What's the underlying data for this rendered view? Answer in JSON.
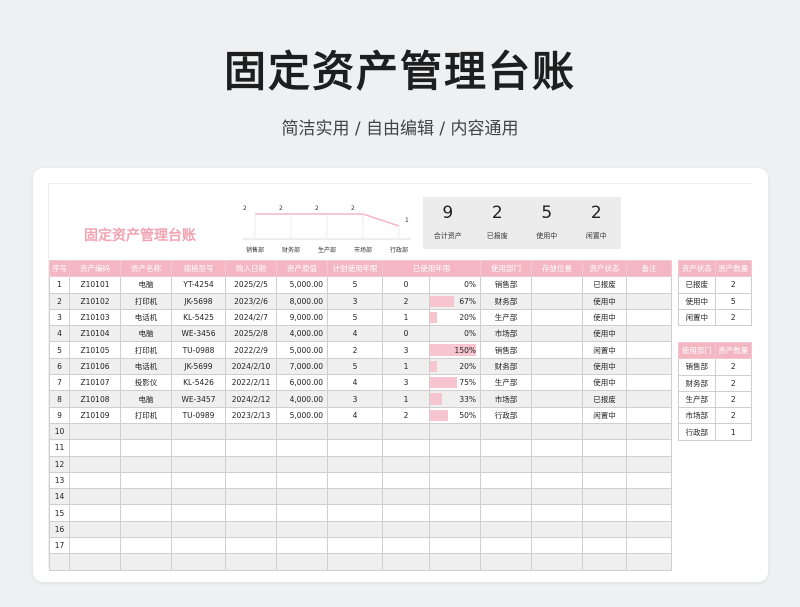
{
  "hero": {
    "title": "固定资产管理台账",
    "subtitle": "简洁实用 / 自由编辑 / 内容通用"
  },
  "sheet": {
    "title": "固定资产管理台账",
    "dept_chart": {
      "type": "line",
      "categories": [
        "销售部",
        "财务部",
        "生产部",
        "市场部",
        "行政部"
      ],
      "values": [
        2,
        2,
        2,
        2,
        1
      ],
      "color": "#f4b6c3"
    },
    "stats": [
      {
        "value": "9",
        "label": "合计资产"
      },
      {
        "value": "2",
        "label": "已报废"
      },
      {
        "value": "5",
        "label": "使用中"
      },
      {
        "value": "2",
        "label": "闲置中"
      }
    ]
  },
  "table": {
    "headers": [
      "序号",
      "资产编码",
      "资产名称",
      "规格型号",
      "购入日期",
      "资产原值",
      "计划使用年限",
      "已使用年限",
      "",
      "使用部门",
      "存放位置",
      "资产状态",
      "备注"
    ],
    "rows": [
      {
        "no": "1",
        "code": "Z10101",
        "name": "电脑",
        "model": "YT-4254",
        "date": "2025/2/5",
        "value": "5,000.00",
        "plan": "5",
        "used": "0",
        "pct": "0%",
        "ratio": 0.0,
        "dept": "销售部",
        "loc": "",
        "status": "已报废",
        "note": ""
      },
      {
        "no": "2",
        "code": "Z10102",
        "name": "打印机",
        "model": "JK-5698",
        "date": "2023/2/6",
        "value": "8,000.00",
        "plan": "3",
        "used": "2",
        "pct": "67%",
        "ratio": 0.67,
        "dept": "财务部",
        "loc": "",
        "status": "使用中",
        "note": ""
      },
      {
        "no": "3",
        "code": "Z10103",
        "name": "电话机",
        "model": "KL-5425",
        "date": "2024/2/7",
        "value": "9,000.00",
        "plan": "5",
        "used": "1",
        "pct": "20%",
        "ratio": 0.2,
        "dept": "生产部",
        "loc": "",
        "status": "使用中",
        "note": ""
      },
      {
        "no": "4",
        "code": "Z10104",
        "name": "电脑",
        "model": "WE-3456",
        "date": "2025/2/8",
        "value": "4,000.00",
        "plan": "4",
        "used": "0",
        "pct": "0%",
        "ratio": 0.0,
        "dept": "市场部",
        "loc": "",
        "status": "使用中",
        "note": ""
      },
      {
        "no": "5",
        "code": "Z10105",
        "name": "打印机",
        "model": "TU-0988",
        "date": "2022/2/9",
        "value": "5,000.00",
        "plan": "2",
        "used": "3",
        "pct": "150%",
        "ratio": 1.5,
        "dept": "销售部",
        "loc": "",
        "status": "闲置中",
        "note": ""
      },
      {
        "no": "6",
        "code": "Z10106",
        "name": "电话机",
        "model": "JK-5699",
        "date": "2024/2/10",
        "value": "7,000.00",
        "plan": "5",
        "used": "1",
        "pct": "20%",
        "ratio": 0.2,
        "dept": "财务部",
        "loc": "",
        "status": "使用中",
        "note": ""
      },
      {
        "no": "7",
        "code": "Z10107",
        "name": "投影仪",
        "model": "KL-5426",
        "date": "2022/2/11",
        "value": "6,000.00",
        "plan": "4",
        "used": "3",
        "pct": "75%",
        "ratio": 0.75,
        "dept": "生产部",
        "loc": "",
        "status": "使用中",
        "note": ""
      },
      {
        "no": "8",
        "code": "Z10108",
        "name": "电脑",
        "model": "WE-3457",
        "date": "2024/2/12",
        "value": "4,000.00",
        "plan": "3",
        "used": "1",
        "pct": "33%",
        "ratio": 0.33,
        "dept": "市场部",
        "loc": "",
        "status": "已报废",
        "note": ""
      },
      {
        "no": "9",
        "code": "Z10109",
        "name": "打印机",
        "model": "TU-0989",
        "date": "2023/2/13",
        "value": "5,000.00",
        "plan": "4",
        "used": "2",
        "pct": "50%",
        "ratio": 0.5,
        "dept": "行政部",
        "loc": "",
        "status": "闲置中",
        "note": ""
      },
      {
        "no": "10"
      },
      {
        "no": "11"
      },
      {
        "no": "12"
      },
      {
        "no": "13"
      },
      {
        "no": "14"
      },
      {
        "no": "15"
      },
      {
        "no": "16"
      },
      {
        "no": "17"
      },
      {
        "no": ""
      }
    ]
  },
  "status_summary": {
    "headers": [
      "资产状态",
      "资产数量"
    ],
    "rows": [
      [
        "已报废",
        "2"
      ],
      [
        "使用中",
        "5"
      ],
      [
        "闲置中",
        "2"
      ]
    ]
  },
  "dept_summary": {
    "headers": [
      "使用部门",
      "资产数量"
    ],
    "rows": [
      [
        "销售部",
        "2"
      ],
      [
        "财务部",
        "2"
      ],
      [
        "生产部",
        "2"
      ],
      [
        "市场部",
        "2"
      ],
      [
        "行政部",
        "1"
      ]
    ]
  }
}
